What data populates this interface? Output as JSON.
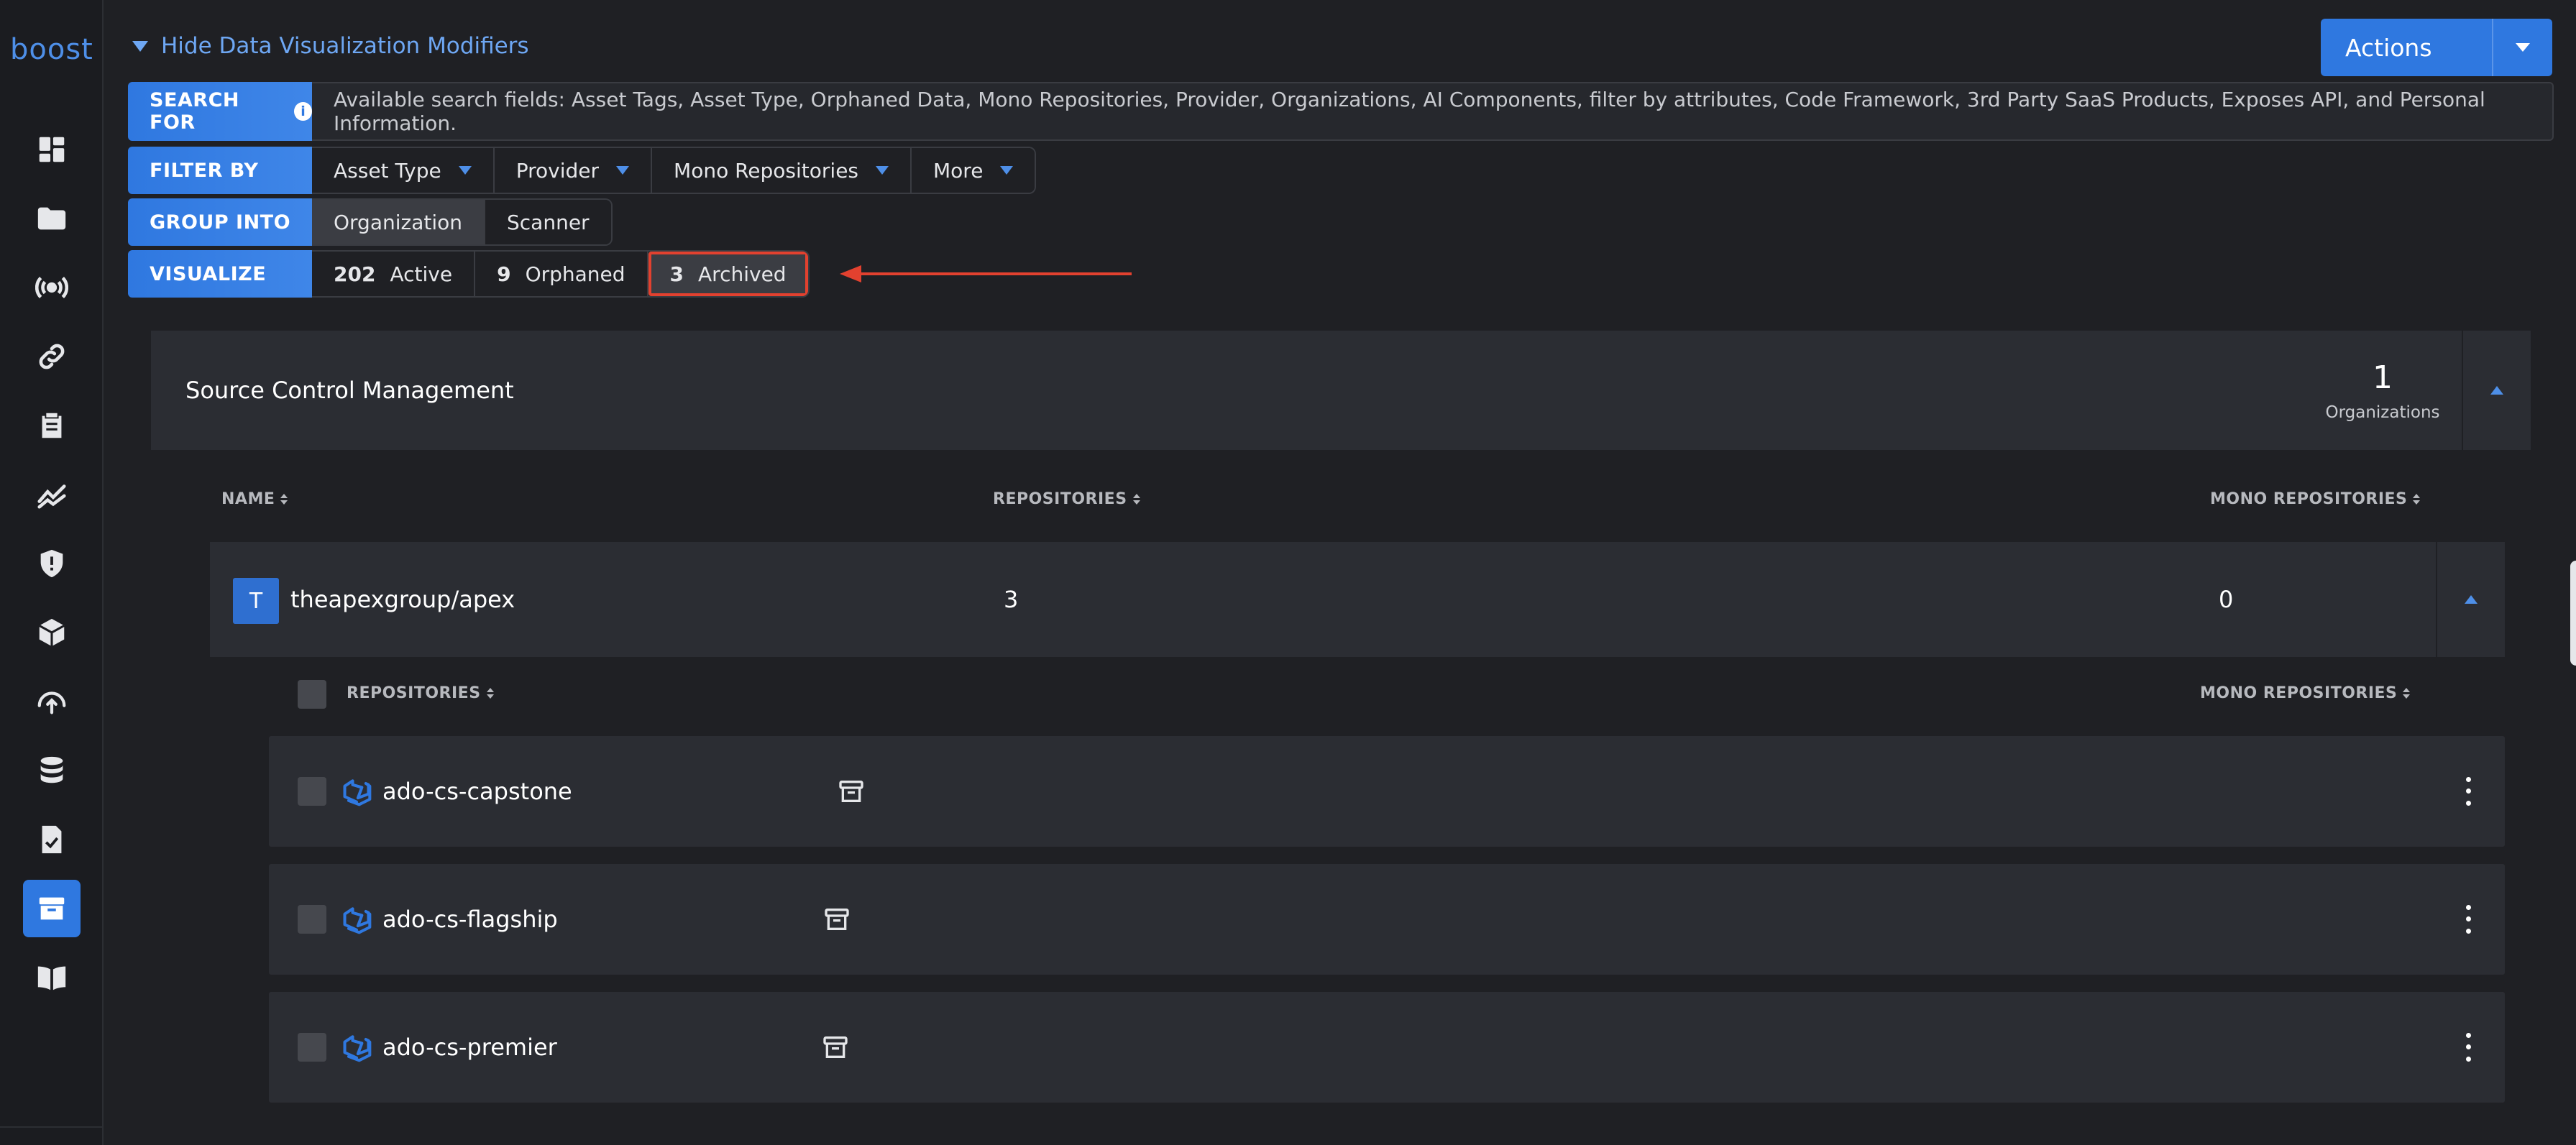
{
  "app": {
    "logo": "boost"
  },
  "sidebar": {
    "items": [
      {
        "icon": "dashboard-icon"
      },
      {
        "icon": "folder-icon"
      },
      {
        "icon": "broadcast-icon"
      },
      {
        "icon": "link-icon"
      },
      {
        "icon": "clipboard-icon"
      },
      {
        "icon": "trend-icon"
      },
      {
        "icon": "shield-icon"
      },
      {
        "icon": "package-icon"
      },
      {
        "icon": "cloud-upload-icon"
      },
      {
        "icon": "database-icon"
      },
      {
        "icon": "document-check-icon"
      },
      {
        "icon": "archive-icon",
        "active": true
      },
      {
        "icon": "book-icon"
      }
    ]
  },
  "toggle": {
    "label": "Hide Data Visualization Modifiers"
  },
  "actions": {
    "label": "Actions"
  },
  "search": {
    "label": "SEARCH FOR",
    "placeholder": "Available search fields: Asset Tags, Asset Type, Orphaned Data, Mono Repositories, Provider, Organizations, AI Components, filter by attributes, Code Framework, 3rd Party SaaS Products, Exposes API, and Personal Information."
  },
  "filter": {
    "label": "FILTER BY",
    "options": [
      "Asset Type",
      "Provider",
      "Mono Repositories",
      "More"
    ]
  },
  "group": {
    "label": "GROUP INTO",
    "options": [
      "Organization",
      "Scanner"
    ],
    "selected": "Organization"
  },
  "visualize": {
    "label": "VISUALIZE",
    "options": [
      {
        "count": "202",
        "label": "Active"
      },
      {
        "count": "9",
        "label": "Orphaned"
      },
      {
        "count": "3",
        "label": "Archived"
      }
    ],
    "selected": "Archived"
  },
  "scm": {
    "title": "Source Control Management",
    "count": "1",
    "count_label": "Organizations"
  },
  "columns": {
    "name": "NAME",
    "repositories": "REPOSITORIES",
    "mono_repositories": "MONO REPOSITORIES"
  },
  "org": {
    "avatar": "T",
    "name": "theapexgroup/apex",
    "repositories": "3",
    "mono_repositories": "0"
  },
  "repo_columns": {
    "repositories": "REPOSITORIES",
    "mono_repositories": "MONO REPOSITORIES"
  },
  "repos": [
    {
      "name": "ado-cs-capstone"
    },
    {
      "name": "ado-cs-flagship"
    },
    {
      "name": "ado-cs-premier"
    }
  ],
  "colors": {
    "accent": "#2f78e0",
    "highlight": "#e2412f",
    "background": "#1f2024",
    "card": "#2b2d33"
  }
}
